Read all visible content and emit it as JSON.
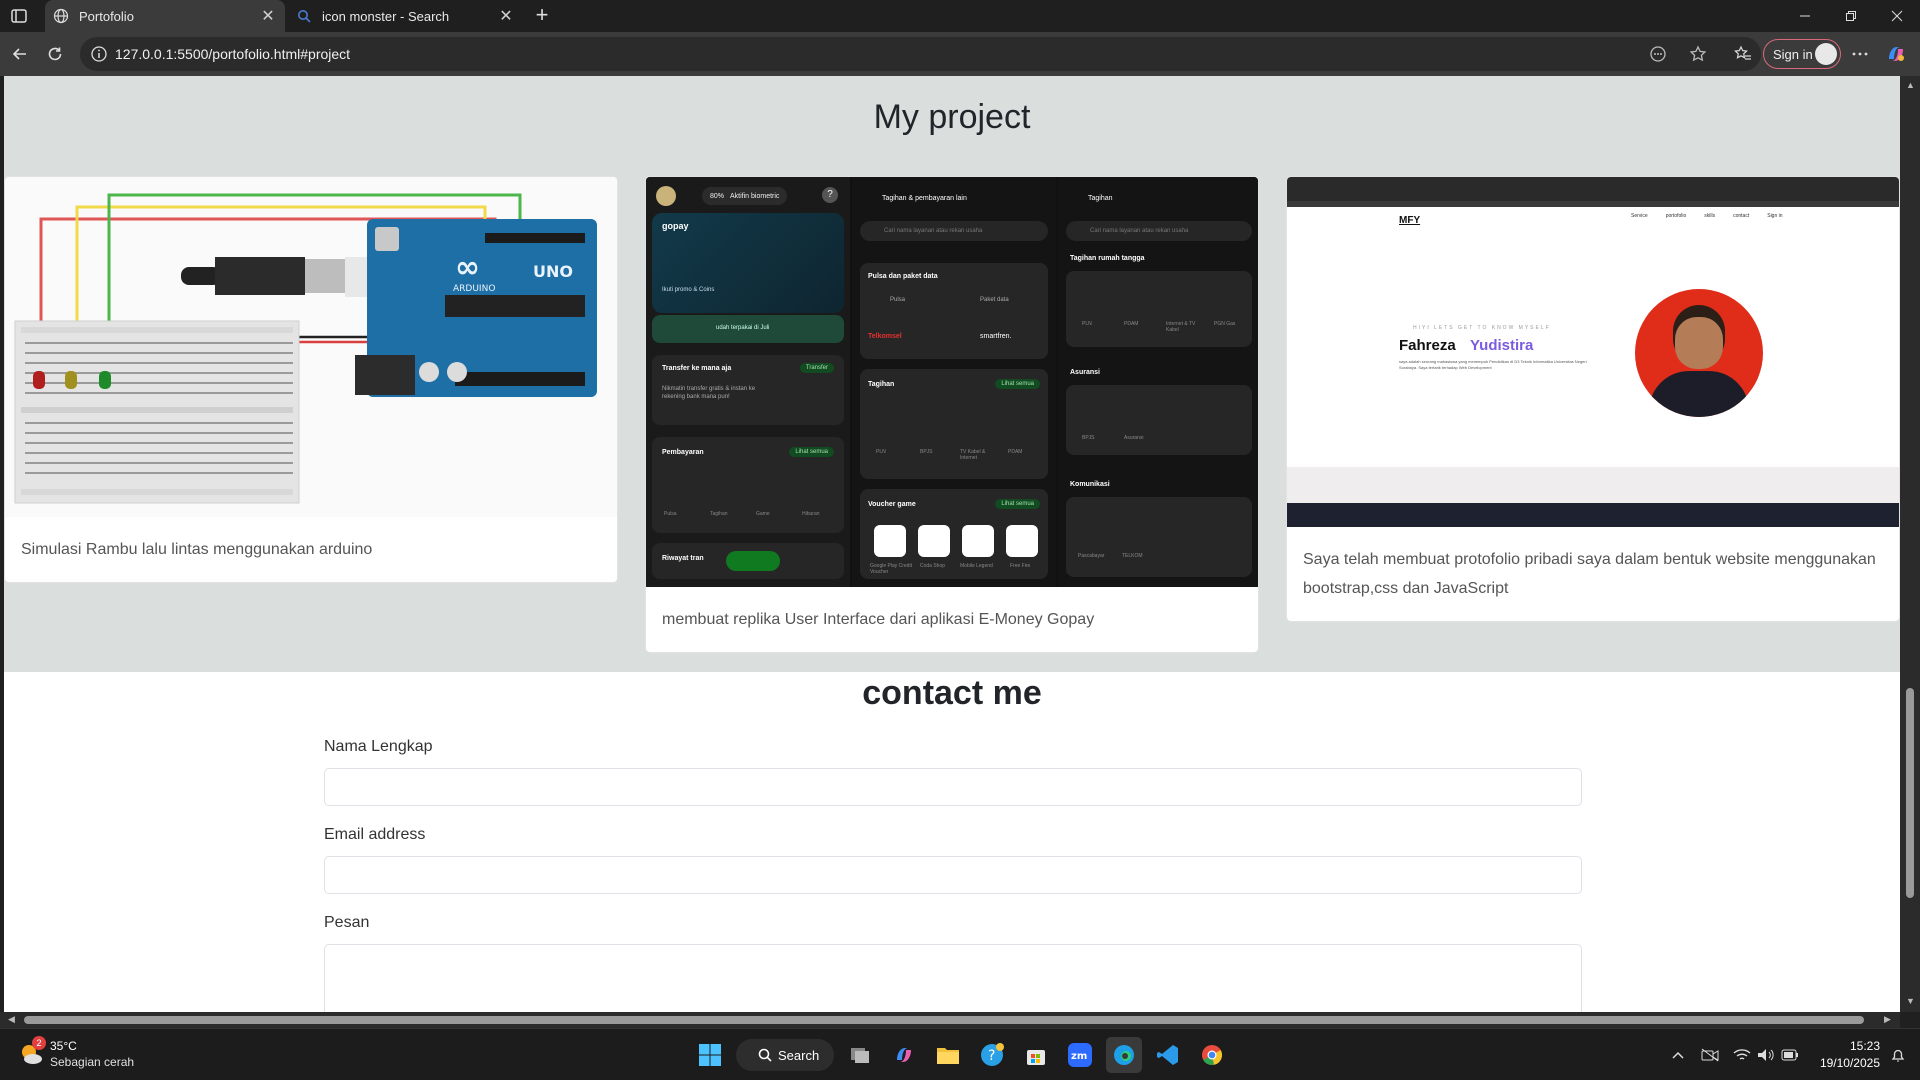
{
  "browser": {
    "tabs": [
      {
        "label": "Portofolio",
        "active": true
      },
      {
        "label": "icon monster - Search",
        "active": false
      }
    ],
    "url": "127.0.0.1:5500/portofolio.html#project",
    "signin_label": "Sign in"
  },
  "page": {
    "project_title": "My project",
    "projects": [
      {
        "caption": "Simulasi Rambu lalu lintas menggunakan arduino"
      },
      {
        "caption": "membuat replika User Interface dari aplikasi E-Money Gopay"
      },
      {
        "caption": "Saya telah membuat protofolio pribadi saya dalam bentuk website menggunakan bootstrap,css dan JavaScript"
      }
    ],
    "arduino_img": {
      "board_label": "UNO",
      "brand": "ARDUINO"
    },
    "gopay_img": {
      "brand": "gopay",
      "badge": "Aktifin biometric",
      "percent": "80%",
      "col2_title": "Tagihan & pembayaran lain",
      "col3_title": "Tagihan",
      "search_placeholder": "Cari nama layanan atau rekan usaha",
      "cards": {
        "pulsa": "Pulsa dan paket data",
        "pulsa_items": [
          "Pulsa",
          "Paket data"
        ],
        "carriers": [
          "Telkomsel",
          "smartfren."
        ],
        "transfer": "Transfer ke mana aja",
        "transfer_btn": "Transfer",
        "transfer_desc": "Nikmatin transfer gratis & instan ke rekening bank mana pun!",
        "pembayaran": "Pembayaran",
        "pembayaran_items": [
          "Pulsa",
          "Tagihan",
          "Game",
          "Hiburan"
        ],
        "tagihan": "Tagihan",
        "tagihan_items": [
          "PLN",
          "BPJS",
          "TV Kabel & Internet",
          "PDAM"
        ],
        "voucher": "Voucher game",
        "voucher_items": [
          "Google Play Credit Voucher",
          "Coda Shop",
          "Mobile Legend",
          "Free Fire"
        ],
        "lihat": "Lihat semua",
        "riwayat": "Riwayat tran",
        "rumah": "Tagihan rumah tangga",
        "rumah_items": [
          "PLN",
          "PDAM",
          "Internet & TV Kabel",
          "PGN Gas"
        ],
        "asuransi": "Asuransi",
        "asuransi_items": [
          "BPJS",
          "Asuransi"
        ],
        "komunikasi": "Komunikasi",
        "komunikasi_items": [
          "Pascabayar",
          "TELKOM"
        ],
        "promo": "Ikuti promo & Coins",
        "used": "udah terpakai di Juli"
      }
    },
    "porto_img": {
      "logo": "MFY",
      "nav": [
        "Service",
        "portofolio",
        "skills",
        "contact",
        "Sign in"
      ],
      "kicker": "HIYI LETS GET TO KNOW MYSELF",
      "first_name": "Fahreza",
      "last_name": "Yudistira",
      "desc": "saya adalah seorang mahasiswa yang menempuh Pendidikan di D3 Teknik Informatika Universitas Negeri Surabaya. Saya tertarik terhadap Web Development"
    },
    "contact_title": "contact me",
    "form": {
      "name_label": "Nama Lengkap",
      "email_label": "Email address",
      "message_label": "Pesan"
    }
  },
  "taskbar": {
    "weather_temp": "35°C",
    "weather_desc": "Sebagian cerah",
    "weather_badge": "2",
    "search_label": "Search",
    "time": "15:23",
    "date": "19/10/2025"
  },
  "colors": {
    "accent_purple": "#7b5be0",
    "gopay_green": "#00aa13",
    "section_bg": "#dadedd"
  }
}
